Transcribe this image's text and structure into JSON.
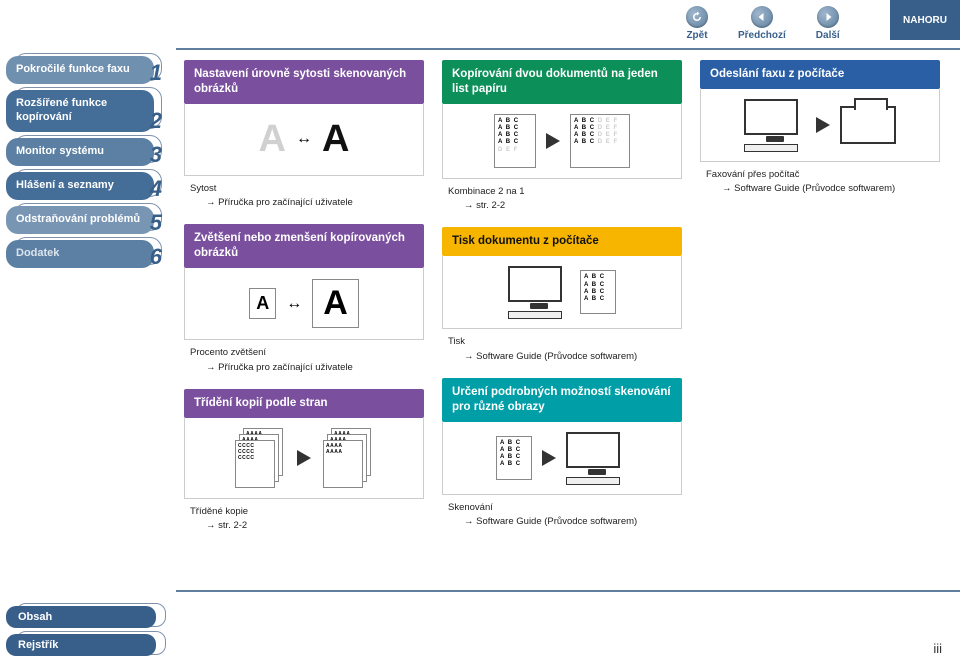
{
  "topnav": {
    "back": "Zpět",
    "prev": "Předchozí",
    "next": "Další",
    "up": "NAHORU"
  },
  "sidebar": {
    "items": [
      {
        "label": "Pokročilé funkce faxu",
        "num": "1"
      },
      {
        "label": "Rozšířené funkce kopírování",
        "num": "2"
      },
      {
        "label": "Monitor systému",
        "num": "3"
      },
      {
        "label": "Hlášení a seznamy",
        "num": "4"
      },
      {
        "label": "Odstraňování problémů",
        "num": "5"
      },
      {
        "label": "Dodatek",
        "num": "6"
      }
    ]
  },
  "bottomnav": {
    "contents": "Obsah",
    "index": "Rejstřík"
  },
  "cards": {
    "col1": [
      {
        "title": "Nastavení úrovně sytosti skenovaných obrázků",
        "ref_title": "Sytost",
        "ref_link": "Příručka pro začínající uživatele"
      },
      {
        "title": "Zvětšení nebo zmenšení kopírovaných obrázků",
        "ref_title": "Procento zvětšení",
        "ref_link": "Příručka pro začínající uživatele"
      },
      {
        "title": "Třídění kopií podle stran",
        "ref_title": "Tříděné kopie",
        "ref_link": "str. 2-2"
      }
    ],
    "col2": [
      {
        "title": "Kopírování dvou dokumentů na jeden list papíru",
        "ref_title": "Kombinace 2 na 1",
        "ref_link": "str. 2-2"
      },
      {
        "title": "Tisk dokumentu z počítače",
        "ref_title": "Tisk",
        "ref_link": "Software Guide (Průvodce softwarem)"
      },
      {
        "title": "Určení podrobných možností skenování pro různé obrazy",
        "ref_title": "Skenování",
        "ref_link": "Software Guide (Průvodce softwarem)"
      }
    ],
    "col3": [
      {
        "title": "Odeslání faxu z počítače",
        "ref_title": "Faxování přes počítač",
        "ref_link": "Software Guide (Průvodce softwarem)"
      }
    ]
  },
  "sample_text": {
    "abc": "A B C",
    "def": "D E F",
    "aaaa": "AAAA",
    "cccc": "CCCC"
  },
  "page_number": "iii"
}
